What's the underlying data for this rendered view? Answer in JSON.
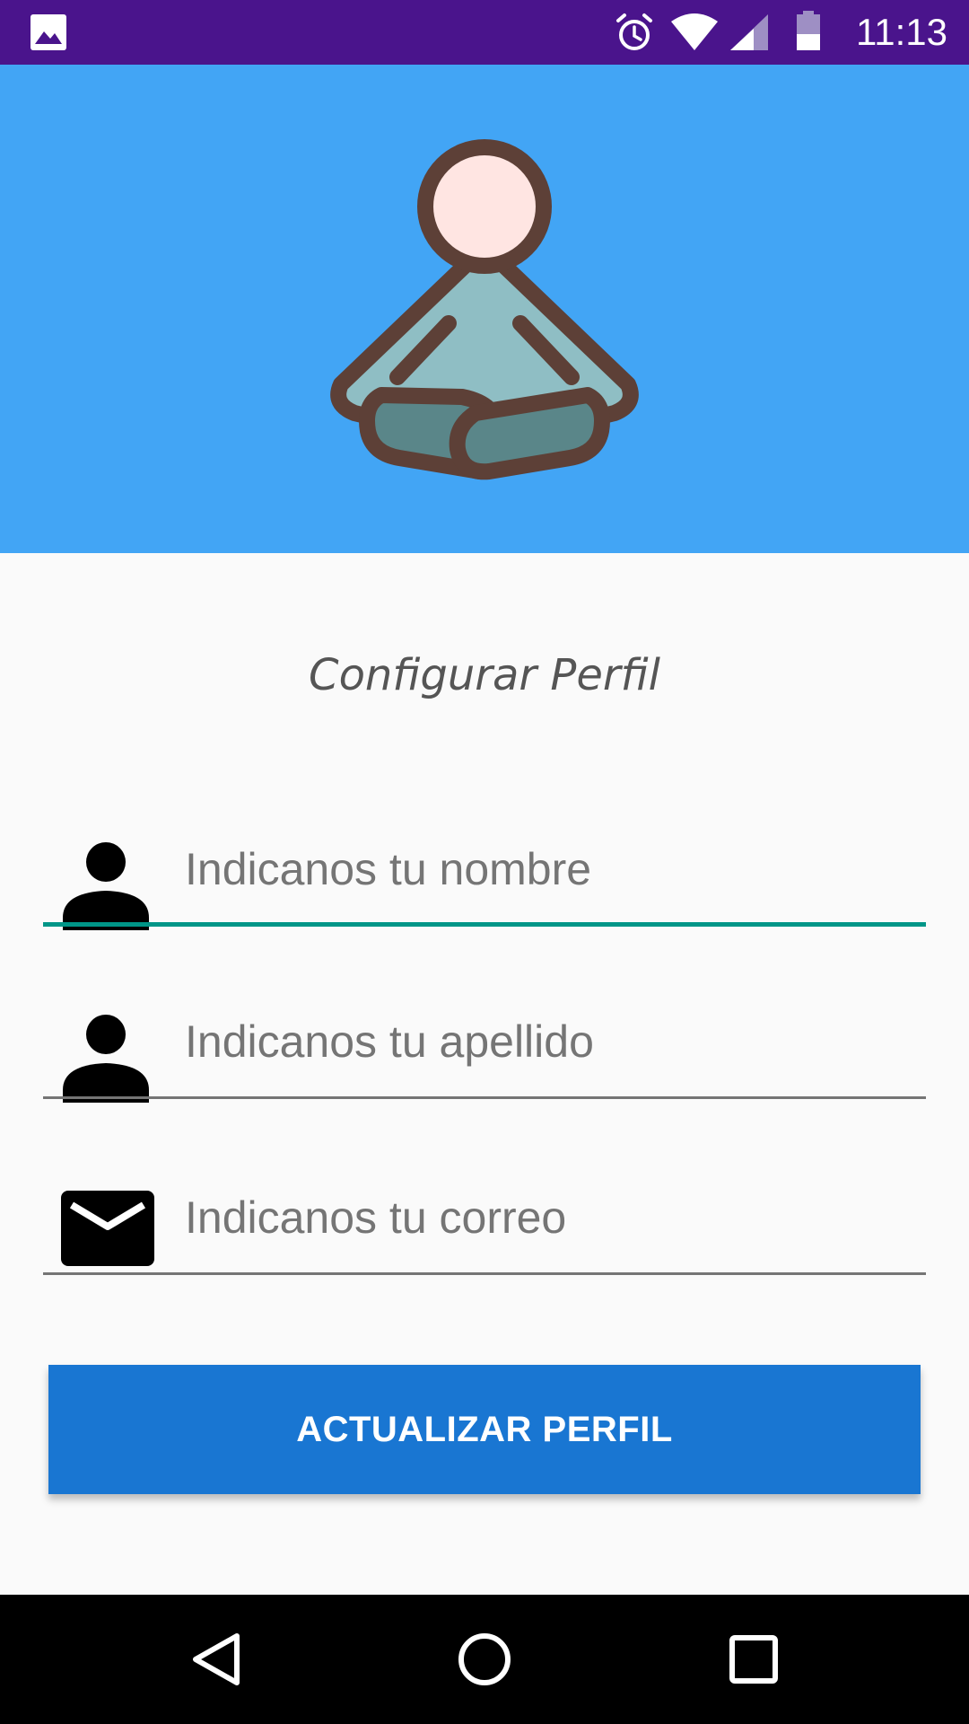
{
  "status_bar": {
    "time": "11:13",
    "icons": [
      "gallery-icon",
      "alarm-icon",
      "wifi-icon",
      "signal-icon",
      "battery-icon"
    ],
    "background": "#4A148C"
  },
  "header": {
    "background": "#42A5F5",
    "logo_icon": "meditation-person-icon"
  },
  "page": {
    "title": "Configurar Perfil"
  },
  "form": {
    "fields": [
      {
        "icon": "person-icon",
        "placeholder": "Indicanos tu nombre",
        "value": "",
        "focused": true
      },
      {
        "icon": "person-icon",
        "placeholder": "Indicanos tu apellido",
        "value": ""
      },
      {
        "icon": "mail-icon",
        "placeholder": "Indicanos tu correo",
        "value": ""
      }
    ],
    "accent_color": "#009688"
  },
  "button": {
    "label": "ACTUALIZAR PERFIL",
    "background": "#1976D2"
  },
  "nav_bar": {
    "icons": [
      "back-icon",
      "home-icon",
      "recents-icon"
    ]
  }
}
